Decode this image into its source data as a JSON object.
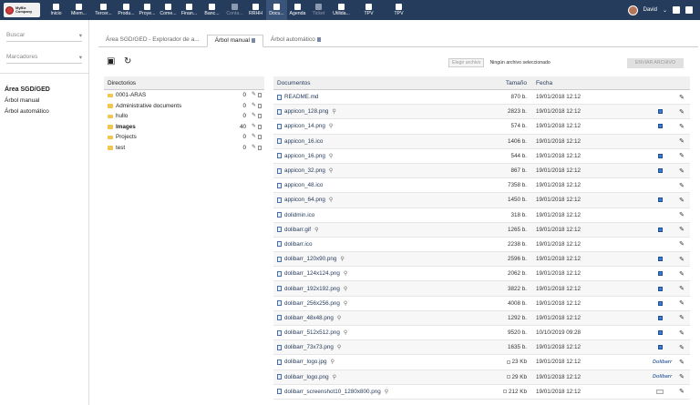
{
  "logo": {
    "lines": [
      "MyBiz",
      "Company"
    ]
  },
  "menu": [
    {
      "label": "Inicio",
      "icon": "home-icon",
      "state": "normal"
    },
    {
      "label": "Miem...",
      "icon": "users-icon",
      "state": "normal"
    },
    {
      "label": "Tercer...",
      "icon": "building-icon",
      "state": "normal"
    },
    {
      "label": "Produ...",
      "icon": "box-icon",
      "state": "normal"
    },
    {
      "label": "Proye...",
      "icon": "project-icon",
      "state": "normal"
    },
    {
      "label": "Come...",
      "icon": "commerce-icon",
      "state": "normal"
    },
    {
      "label": "Finan...",
      "icon": "finance-icon",
      "state": "normal"
    },
    {
      "label": "Banc...",
      "icon": "bank-icon",
      "state": "normal"
    },
    {
      "label": "Conta...",
      "icon": "accounting-icon",
      "state": "dim"
    },
    {
      "label": "RRHH",
      "icon": "hr-icon",
      "state": "normal"
    },
    {
      "label": "Docu...",
      "icon": "documents-icon",
      "state": "active"
    },
    {
      "label": "Agenda",
      "icon": "calendar-icon",
      "state": "normal"
    },
    {
      "label": "Ticket",
      "icon": "ticket-icon",
      "state": "dim"
    },
    {
      "label": "Utilida...",
      "icon": "tools-icon",
      "state": "normal"
    },
    {
      "label": "TPV",
      "icon": "pos-icon",
      "state": "normal"
    },
    {
      "label": "TPV",
      "icon": "pos-icon",
      "state": "normal"
    }
  ],
  "user": {
    "name": "David"
  },
  "left": {
    "search_label": "Buscar",
    "bookmarks_label": "Marcadores",
    "section_title": "Área SGD/GED",
    "items": [
      "Árbol manual",
      "Árbol automático"
    ]
  },
  "tabs": [
    {
      "label": "Área SGD/GED - Explorador de a..."
    },
    {
      "label": "Árbol manual"
    },
    {
      "label": "Árbol automático"
    }
  ],
  "upload": {
    "choose_label": "Elegir archivo",
    "no_file_label": "Ningún archivo seleccionado",
    "send_label": "ENVIAR ARCHIVO"
  },
  "directories": {
    "header": "Directorios",
    "rows": [
      {
        "name": "0001-ARAS",
        "count": "0",
        "bold": false
      },
      {
        "name": "Administrative documents",
        "count": "0",
        "bold": false
      },
      {
        "name": "hullo",
        "count": "0",
        "bold": false
      },
      {
        "name": "Images",
        "count": "40",
        "bold": true
      },
      {
        "name": "Projects",
        "count": "0",
        "bold": false
      },
      {
        "name": "test",
        "count": "0",
        "bold": false
      }
    ]
  },
  "files": {
    "headers": {
      "name": "Documentos",
      "size": "Tamaño",
      "date": "Fecha"
    },
    "rows": [
      {
        "name": "README.md",
        "size": "870 b.",
        "date": "19/01/2018 12:12",
        "zoom": false,
        "preview": "none"
      },
      {
        "name": "appicon_128.png",
        "size": "2823 b.",
        "date": "19/01/2018 12:12",
        "zoom": true,
        "preview": "thumb"
      },
      {
        "name": "appicon_14.png",
        "size": "574 b.",
        "date": "19/01/2018 12:12",
        "zoom": true,
        "preview": "thumb"
      },
      {
        "name": "appicon_16.ico",
        "size": "1406 b.",
        "date": "19/01/2018 12:12",
        "zoom": false,
        "preview": "none"
      },
      {
        "name": "appicon_16.png",
        "size": "544 b.",
        "date": "19/01/2018 12:12",
        "zoom": true,
        "preview": "thumb"
      },
      {
        "name": "appicon_32.png",
        "size": "867 b.",
        "date": "19/01/2018 12:12",
        "zoom": true,
        "preview": "thumb"
      },
      {
        "name": "appicon_48.ico",
        "size": "7358 b.",
        "date": "19/01/2018 12:12",
        "zoom": false,
        "preview": "none"
      },
      {
        "name": "appicon_64.png",
        "size": "1450 b.",
        "date": "19/01/2018 12:12",
        "zoom": true,
        "preview": "thumb"
      },
      {
        "name": "dolidmin.ico",
        "size": "318 b.",
        "date": "19/01/2018 12:12",
        "zoom": false,
        "preview": "none"
      },
      {
        "name": "dolibarr.gif",
        "size": "1265 b.",
        "date": "19/01/2018 12:12",
        "zoom": true,
        "preview": "thumb"
      },
      {
        "name": "dolibarr.ico",
        "size": "2238 b.",
        "date": "19/01/2018 12:12",
        "zoom": false,
        "preview": "none"
      },
      {
        "name": "dolibarr_120x90.png",
        "size": "2596 b.",
        "date": "19/01/2018 12:12",
        "zoom": true,
        "preview": "thumb"
      },
      {
        "name": "dolibarr_124x124.png",
        "size": "2062 b.",
        "date": "19/01/2018 12:12",
        "zoom": true,
        "preview": "thumb"
      },
      {
        "name": "dolibarr_192x192.png",
        "size": "3822 b.",
        "date": "19/01/2018 12:12",
        "zoom": true,
        "preview": "thumb"
      },
      {
        "name": "dolibarr_256x256.png",
        "size": "4008 b.",
        "date": "19/01/2018 12:12",
        "zoom": true,
        "preview": "thumb"
      },
      {
        "name": "dolibarr_48x48.png",
        "size": "1292 b.",
        "date": "19/01/2018 12:12",
        "zoom": true,
        "preview": "thumb"
      },
      {
        "name": "dolibarr_512x512.png",
        "size": "9520 b.",
        "date": "10/10/2019 09:28",
        "zoom": true,
        "preview": "thumb"
      },
      {
        "name": "dolibarr_73x73.png",
        "size": "1635 b.",
        "date": "19/01/2018 12:12",
        "zoom": true,
        "preview": "thumb"
      },
      {
        "name": "dolibarr_logo.jpg",
        "size": "23 Kb",
        "date": "19/01/2018 12:12",
        "zoom": true,
        "preview": "brand",
        "brand_text": "Dolibarr"
      },
      {
        "name": "dolibarr_logo.png",
        "size": "29 Kb",
        "date": "19/01/2018 12:12",
        "zoom": true,
        "preview": "brand",
        "brand_text": "Dolibarr"
      },
      {
        "name": "dolibarr_screenshot10_1280x800.png",
        "size": "212 Kb",
        "date": "19/01/2018 12:12",
        "zoom": true,
        "preview": "shot"
      }
    ]
  }
}
